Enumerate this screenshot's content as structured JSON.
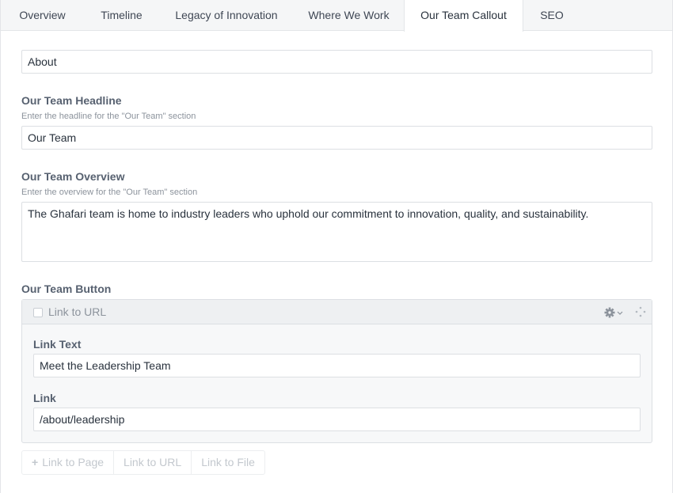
{
  "tabs": [
    {
      "label": "Overview"
    },
    {
      "label": "Timeline"
    },
    {
      "label": "Legacy of Innovation"
    },
    {
      "label": "Where We Work"
    },
    {
      "label": "Our Team Callout",
      "active": true
    },
    {
      "label": "SEO"
    }
  ],
  "fields": {
    "eyebrow": {
      "value": "About"
    },
    "headline": {
      "label": "Our Team Headline",
      "help": "Enter the headline for the \"Our Team\" section",
      "value": "Our Team"
    },
    "overview": {
      "label": "Our Team Overview",
      "help": "Enter the overview for the \"Our Team\" section",
      "value": "The Ghafari team is home to industry leaders who uphold our commitment to innovation, quality, and sustainability."
    },
    "button": {
      "label": "Our Team Button",
      "block": {
        "title": "Link to URL",
        "icons": [
          "gear-icon",
          "chevron-down-icon",
          "move-icon"
        ],
        "link_text": {
          "label": "Link Text",
          "value": "Meet the Leadership Team"
        },
        "link": {
          "label": "Link",
          "value": "/about/leadership"
        }
      },
      "add_buttons": [
        {
          "label": "Link to Page",
          "icon": "plus-icon"
        },
        {
          "label": "Link to URL"
        },
        {
          "label": "Link to File"
        }
      ]
    }
  },
  "colors": {
    "tab_bar": "#f5f6f7",
    "border": "#dcdfe3",
    "label": "#576170",
    "help": "#8c939c"
  }
}
